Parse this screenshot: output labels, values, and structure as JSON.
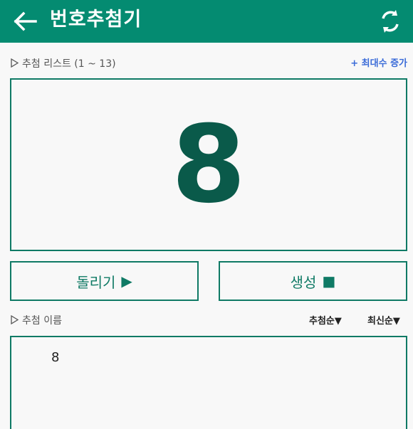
{
  "header": {
    "title": "번호추첨기",
    "back_icon": "arrow-left-icon",
    "refresh_icon": "refresh-icon",
    "background_color": "#048b71"
  },
  "draw_section": {
    "label": "추첨 리스트 (1 ~ 13)",
    "add_link": "+ 최대수 증가",
    "current_number": "8"
  },
  "buttons": {
    "spin_label": "돌리기",
    "spin_icon": "▶",
    "generate_label": "생성",
    "generate_icon": "■"
  },
  "names_section": {
    "label": "추첨 이름",
    "sort_draw_order": "추첨순▼",
    "sort_newest": "최신순▼",
    "items": [
      "8"
    ]
  },
  "colors": {
    "accent": "#048b71",
    "border": "#0f7a65",
    "number": "#0a5a4a",
    "link": "#3a6bd8"
  }
}
